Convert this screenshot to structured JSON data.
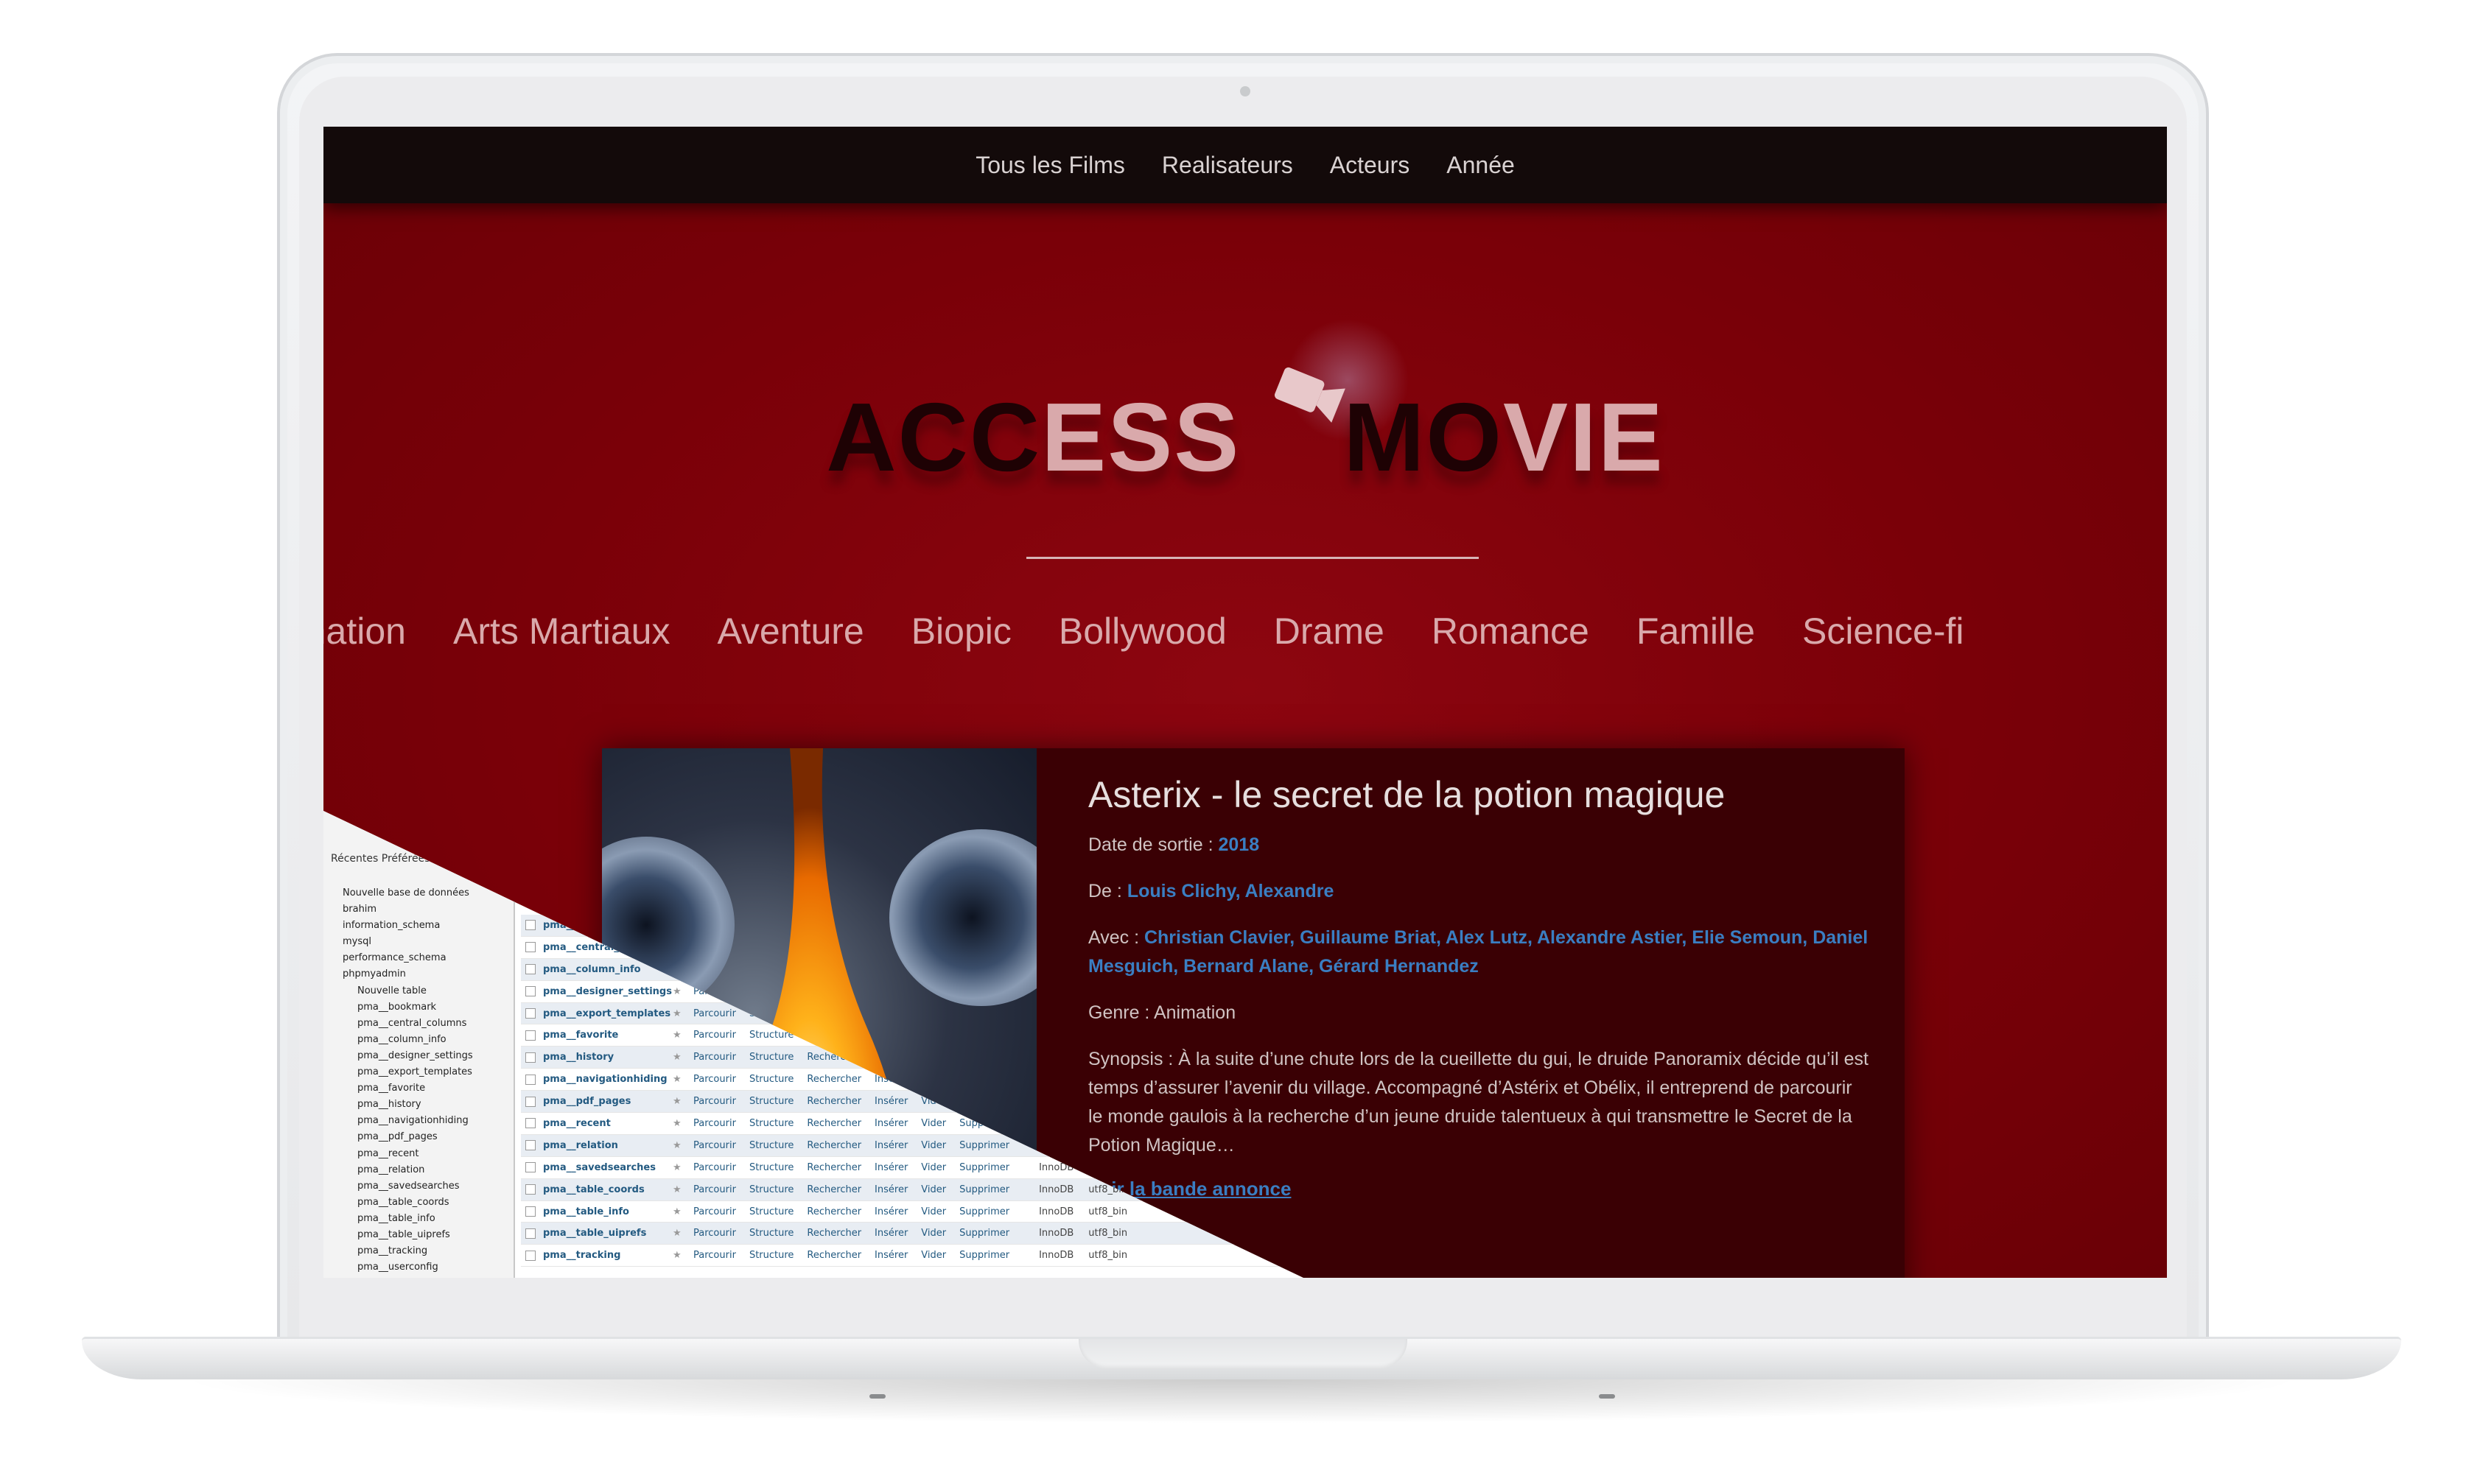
{
  "nav": {
    "items": [
      "Tous les Films",
      "Realisateurs",
      "Acteurs",
      "Année"
    ]
  },
  "logo": {
    "part1_dark": "ACC",
    "part1_light": "ESS",
    "part2_dark": "MO",
    "part2_light": "VIE"
  },
  "genres": [
    "on",
    "Animation",
    "Arts Martiaux",
    "Aventure",
    "Biopic",
    "Bollywood",
    "Drame",
    "Romance",
    "Famille",
    "Science-fi"
  ],
  "movie": {
    "title": "Asterix - le secret de la potion magique",
    "release_label": "Date de sortie :",
    "release_year": "2018",
    "director_label": "De :",
    "director": "Louis Clichy, Alexandre",
    "cast_label": "Avec :",
    "cast": "Christian Clavier, Guillaume Briat, Alex Lutz, Alexandre Astier, Elie Semoun, Daniel Mesguich, Bernard Alane, Gérard Hernandez",
    "genre": "Genre : Animation",
    "synopsis": "Synopsis : À la suite d’une chute lors de la cueillette du gui, le druide Panoramix décide qu’il est temps d’assurer l’avenir du village. Accompagné d’Astérix et Obélix, il entreprend de parcourir le monde gaulois à la recherche d’un jeune druide talentueux à qui transmettre le Secret de la Potion Magique…",
    "trailer": "Voir la bande annonce"
  },
  "colors": {
    "hero_red": "#7a0008",
    "nav_bg": "#130a0a",
    "link_blue": "#3a7ec2",
    "card_bg": "#3a0004"
  },
  "pma": {
    "tabs": "Récentes   Préférées",
    "tree": [
      "Nouvelle base de données",
      "brahim",
      "information_schema",
      "mysql",
      "performance_schema",
      "phpmyadmin",
      "Nouvelle table",
      "pma__bookmark",
      "pma__central_columns",
      "pma__column_info",
      "pma__designer_settings",
      "pma__export_templates",
      "pma__favorite",
      "pma__history",
      "pma__navigationhiding",
      "pma__pdf_pages",
      "pma__recent",
      "pma__relation",
      "pma__savedsearches",
      "pma__table_coords",
      "pma__table_info",
      "pma__table_uiprefs",
      "pma__tracking",
      "pma__userconfig"
    ],
    "actions": {
      "browse": "Parcourir",
      "structure": "Structure",
      "search": "Rechercher",
      "insert": "Insérer",
      "empty": "Vider",
      "drop": "Supprimer",
      "engine": "InnoDB",
      "collation": "utf8_bin"
    },
    "tables": [
      "pma__bookmark",
      "pma__central_columns",
      "pma__column_info",
      "pma__designer_settings",
      "pma__export_templates",
      "pma__favorite",
      "pma__history",
      "pma__navigationhiding",
      "pma__pdf_pages",
      "pma__recent",
      "pma__relation",
      "pma__savedsearches",
      "pma__table_coords",
      "pma__table_info",
      "pma__table_uiprefs",
      "pma__tracking"
    ]
  }
}
